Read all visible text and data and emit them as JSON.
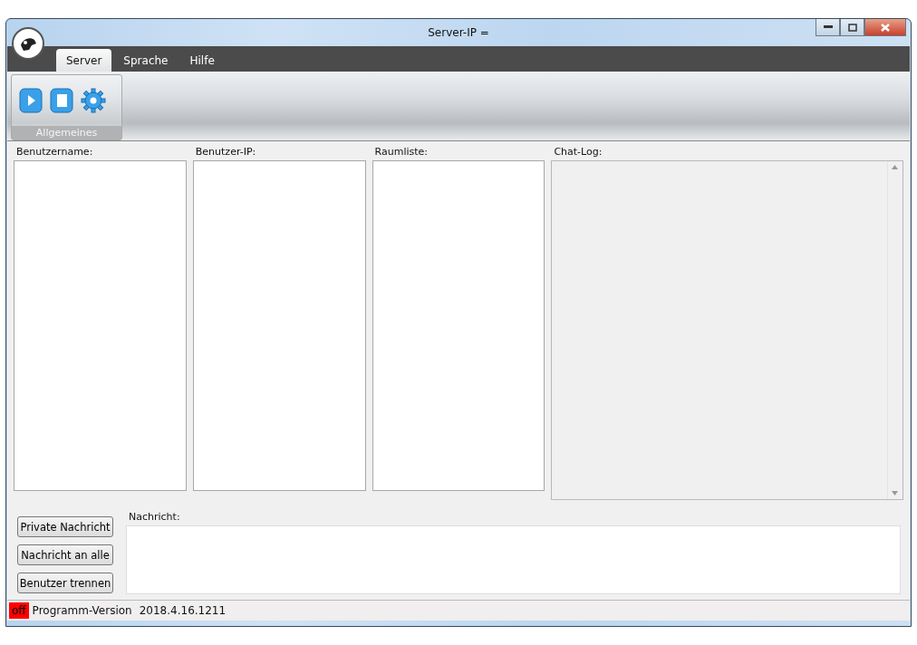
{
  "window": {
    "title": "Server-IP ="
  },
  "tabs": [
    {
      "label": "Server",
      "selected": true
    },
    {
      "label": "Sprache",
      "selected": false
    },
    {
      "label": "Hilfe",
      "selected": false
    }
  ],
  "ribbon": {
    "group": "Allgemeines"
  },
  "panels": [
    {
      "label": "Benutzername:",
      "kind": "list"
    },
    {
      "label": "Benutzer-IP:",
      "kind": "list"
    },
    {
      "label": "Raumliste:",
      "kind": "list"
    },
    {
      "label": "Chat-Log:",
      "kind": "log"
    }
  ],
  "buttons": [
    "Private Nachricht",
    "Nachricht an alle",
    "Benutzer trennen"
  ],
  "message": {
    "label": "Nachricht:"
  },
  "status_bar": {
    "state": {
      "text": "off",
      "online": false
    },
    "version_label": "Programm-Version",
    "version": "2018.4.16.1211"
  }
}
